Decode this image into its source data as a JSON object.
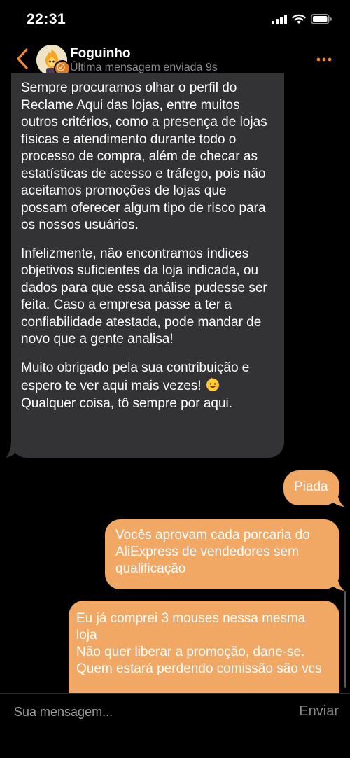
{
  "status_bar": {
    "time": "22:31"
  },
  "header": {
    "contact_name": "Foguinho",
    "contact_status": "Última mensagem enviada 9s"
  },
  "messages": {
    "incoming": {
      "p1": "Sempre procuramos olhar o perfil do Reclame Aqui das lojas, entre muitos outros critérios, como a presença de lojas físicas e atendimento durante todo o processo de compra, além de checar as estatísticas de acesso e tráfego, pois não aceitamos promoções de lojas que possam oferecer algum tipo de risco para os nossos usuários.",
      "p2": "Infelizmente, não encontramos índices objetivos suficientes da loja indicada, ou dados para que essa análise pudesse ser feita. Caso a empresa passe a ter a confiabilidade atestada, pode mandar de novo que a gente analisa!",
      "p3_a": "Muito obrigado pela sua contribuição e espero te ver aqui mais vezes!",
      "p3_b": "Qualquer coisa, tô sempre por aqui."
    },
    "outgoing": [
      {
        "text": "Piada"
      },
      {
        "text": "Vocês aprovam cada porcaria do AliExpress de vendedores sem qualificação"
      },
      {
        "line1": "Eu já comprei 3 mouses nessa mesma loja",
        "line2": "Não quer liberar a promoção, dane-se.",
        "line3": "Quem estará perdendo comissão são vcs"
      }
    ]
  },
  "composer": {
    "placeholder": "Sua mensagem...",
    "send_label": "Enviar"
  },
  "colors": {
    "accent": "#f08a2c",
    "outgoing_bubble": "#f2a865",
    "incoming_bubble": "#333335"
  }
}
